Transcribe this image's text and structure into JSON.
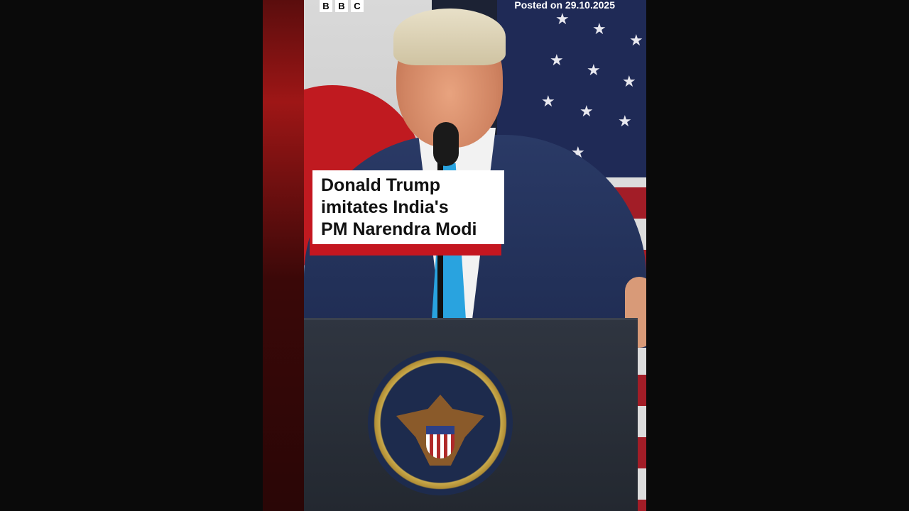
{
  "video": {
    "logo_letters": [
      "B",
      "B",
      "C"
    ],
    "posted_label": "Posted on 29.10.2025",
    "caption_lines": [
      "Donald Trump",
      "imitates India's",
      "PM Narendra Modi"
    ]
  },
  "colors": {
    "page_background": "#0a0a0a",
    "caption_background": "#ffffff",
    "caption_accent": "#c41620",
    "caption_text": "#111111"
  },
  "icons": {
    "brand": "bbc-logo",
    "seal": "presidential-seal"
  }
}
